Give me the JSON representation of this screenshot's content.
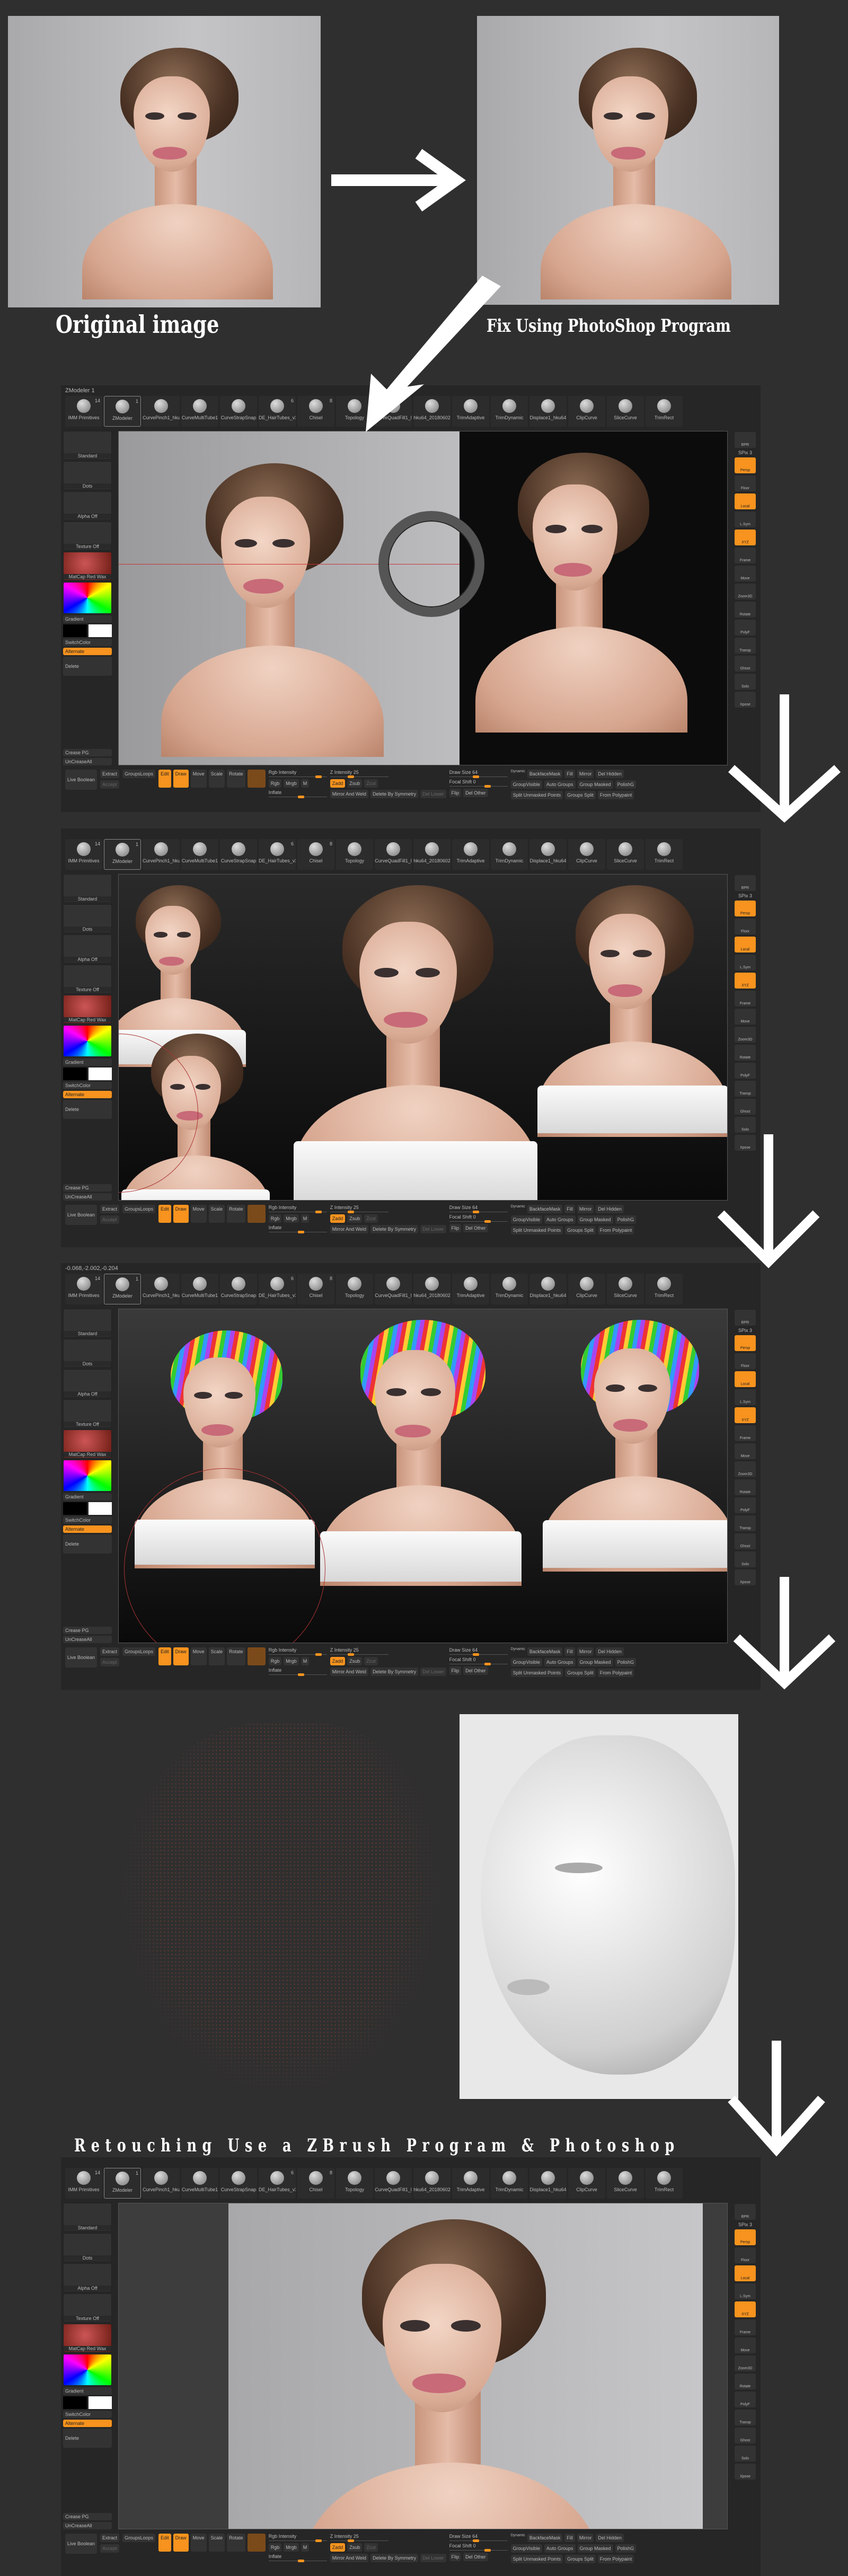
{
  "captions": {
    "original": "Original image",
    "fix": "Fix Using PhotoShop Program",
    "retouch": "Retouching Use a ZBrush Program & Photoshop"
  },
  "panels": [
    {
      "title": "ZModeler 1",
      "scene": "photo-split"
    },
    {
      "title": "",
      "scene": "busts"
    },
    {
      "title": "-0.068,-2.002,-0.204",
      "scene": "hair"
    },
    {
      "title": "",
      "scene": "final"
    }
  ],
  "zbrush": {
    "brushes": [
      {
        "label": "IMM Primitives",
        "count": "14"
      },
      {
        "label": "ZModeler",
        "count": "1"
      },
      {
        "label": "CurvePinch1_hku",
        "count": ""
      },
      {
        "label": "CurveMultiTube1",
        "count": ""
      },
      {
        "label": "CurveStrapSnap",
        "count": ""
      },
      {
        "label": "DE_HairTubes_v3",
        "count": "6"
      },
      {
        "label": "Chisel",
        "count": "8"
      },
      {
        "label": "Topology",
        "count": ""
      },
      {
        "label": "CurveQuadFill1_l",
        "count": ""
      },
      {
        "label": "hku64_20180602",
        "count": ""
      },
      {
        "label": "TrimAdaptive",
        "count": ""
      },
      {
        "label": "TrimDynamic",
        "count": ""
      },
      {
        "label": "Displace1_hku64",
        "count": ""
      },
      {
        "label": "ClipCurve",
        "count": ""
      },
      {
        "label": "SliceCurve",
        "count": ""
      },
      {
        "label": "TrimRect",
        "count": ""
      }
    ],
    "left": {
      "brush": "Standard",
      "stroke": "Dots",
      "alpha": "Alpha Off",
      "texture": "Texture Off",
      "material": "MatCap Red Wax",
      "gradient": "Gradient",
      "switch": "SwitchColor",
      "alternate": "Alternate",
      "delete": "Delete",
      "crease": "Crease PG",
      "uncrease": "UnCreaseAll",
      "boolean": "Live Boolean"
    },
    "right": [
      "BPR",
      "SPix 3",
      "Persp",
      "Floor",
      "Local",
      "L.Sym",
      "XYZ",
      "Frame",
      "Move",
      "Zoom3D",
      "Rotate",
      "PolyF",
      "Transp",
      "Ghost",
      "Solo",
      "Xpose"
    ],
    "bottom": {
      "extract": "Extract",
      "accept": "Accept",
      "groupsloops": "GroupsLoops",
      "edit": "Edit",
      "draw": "Draw",
      "move": "Move",
      "scale": "Scale",
      "rotate": "Rotate",
      "rgb_intensity": "Rgb Intensity",
      "rgb": "Rgb",
      "mrgb": "Mrgb",
      "m": "M",
      "zadd": "Zadd",
      "zsub": "Zsub",
      "zcut": "Zcut",
      "z_intensity": "Z Intensity 25",
      "draw_size": "Draw Size 64",
      "dynamic": "Dynamic",
      "focal": "Focal Shift 0",
      "inflate": "Inflate",
      "mirror_weld": "Mirror And Weld",
      "delete_sym": "Delete By Symmetry",
      "del_lower": "Del Lower",
      "flip": "Flip",
      "del_other": "Del Other",
      "backface": "BackfaceMask",
      "fill": "Fill",
      "mirror": "Mirror",
      "del_hidden": "Del Hidden",
      "group_visible": "GroupVisible",
      "auto_groups": "Auto Groups",
      "group_masked": "Group Masked",
      "polishg": "PolishG",
      "split_unmasked": "Split Unmasked Points",
      "groups_split": "Groups Split",
      "from_polypaint": "From Polypaint"
    }
  },
  "colors": {
    "accent": "#f7931e",
    "bg": "#2f2f2f"
  }
}
